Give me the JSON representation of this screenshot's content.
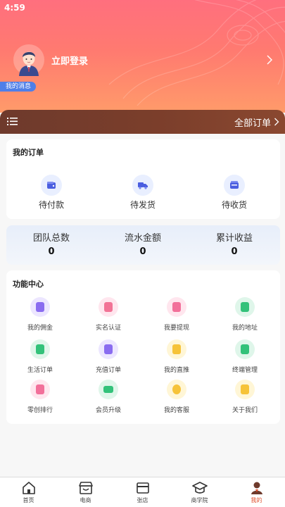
{
  "status_bar": {
    "time": "4:59"
  },
  "header": {
    "login_label": "立即登录",
    "messages_badge": "我的消息"
  },
  "orders_bar": {
    "all_orders_label": "全部订单"
  },
  "my_orders": {
    "title": "我的订单",
    "items": [
      {
        "label": "待付款",
        "icon": "wallet-icon"
      },
      {
        "label": "待发货",
        "icon": "truck-icon"
      },
      {
        "label": "待收货",
        "icon": "package-icon"
      }
    ]
  },
  "stats": [
    {
      "label": "团队总数",
      "value": "0"
    },
    {
      "label": "流水金额",
      "value": "0"
    },
    {
      "label": "累计收益",
      "value": "0"
    }
  ],
  "function_center": {
    "title": "功能中心",
    "items": [
      {
        "label": "我的佣金",
        "icon": "commission-icon",
        "bg": "#ece6ff",
        "fg": "#8a6cf0"
      },
      {
        "label": "实名认证",
        "icon": "verify-icon",
        "bg": "#ffe6ee",
        "fg": "#f27396"
      },
      {
        "label": "我要提现",
        "icon": "withdraw-icon",
        "bg": "#ffe6ee",
        "fg": "#f2709a"
      },
      {
        "label": "我的地址",
        "icon": "address-icon",
        "bg": "#dff6ea",
        "fg": "#33c27a"
      },
      {
        "label": "生活订单",
        "icon": "life-order-icon",
        "bg": "#dff6ea",
        "fg": "#33c27a"
      },
      {
        "label": "充值订单",
        "icon": "recharge-order-icon",
        "bg": "#ece6ff",
        "fg": "#8a6cf0"
      },
      {
        "label": "我的直推",
        "icon": "direct-push-icon",
        "bg": "#fff6d6",
        "fg": "#f6c339"
      },
      {
        "label": "终端管理",
        "icon": "terminal-icon",
        "bg": "#dff6ea",
        "fg": "#33c27a"
      },
      {
        "label": "零创排行",
        "icon": "ranking-icon",
        "bg": "#ffe6ee",
        "fg": "#f2709a"
      },
      {
        "label": "会员升级",
        "icon": "member-upgrade-icon",
        "bg": "#dff6ea",
        "fg": "#33c27a"
      },
      {
        "label": "我的客服",
        "icon": "customer-service-icon",
        "bg": "#fff6d6",
        "fg": "#f6c339"
      },
      {
        "label": "关于我们",
        "icon": "about-icon",
        "bg": "#fff6d6",
        "fg": "#f6c339"
      }
    ]
  },
  "tabbar": {
    "items": [
      {
        "label": "首页",
        "icon": "home-icon"
      },
      {
        "label": "电商",
        "icon": "shop-icon"
      },
      {
        "label": "张店",
        "icon": "wallet-card-icon"
      },
      {
        "label": "商学院",
        "icon": "graduation-icon"
      },
      {
        "label": "我的",
        "icon": "profile-icon",
        "active": true
      }
    ],
    "active_color": "#e0502e"
  }
}
